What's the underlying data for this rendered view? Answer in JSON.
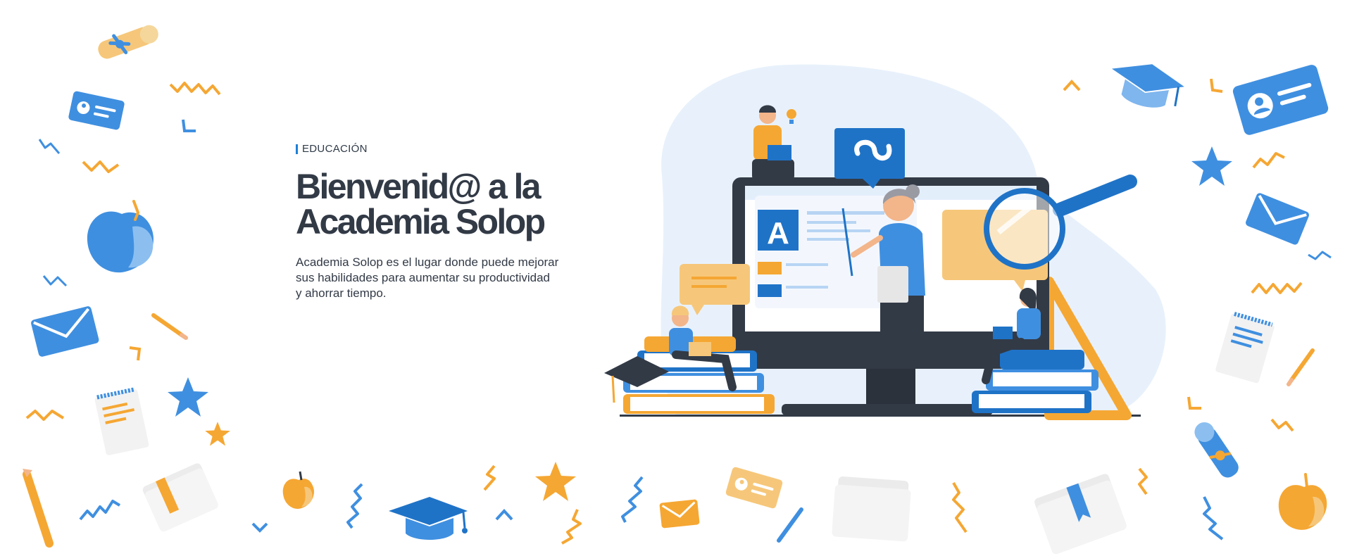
{
  "hero": {
    "eyebrow": "EDUCACIÓN",
    "title_line1": "Bienvenid@ a la",
    "title_line2": "Academia Solop",
    "description_line1": "Academia Solop es el lugar donde puede mejorar",
    "description_line2": "sus habilidades para aumentar su productividad",
    "description_line3": "y ahorrar tiempo."
  },
  "illustration": {
    "screen_letter": "A",
    "icons": [
      "solop-logo-icon",
      "graduation-cap-icon",
      "id-card-icon",
      "envelope-icon",
      "star-icon",
      "apple-icon",
      "diploma-icon",
      "pencil-icon",
      "folder-icon",
      "notepad-icon",
      "magnifier-icon",
      "book-stack-icon",
      "monitor-icon"
    ]
  },
  "colors": {
    "blue": "#3f8fe0",
    "blue_dark": "#1f73c7",
    "orange": "#f5a733",
    "orange_light": "#f6c77a",
    "dark": "#323a46",
    "blob": "#e8f1fb"
  }
}
